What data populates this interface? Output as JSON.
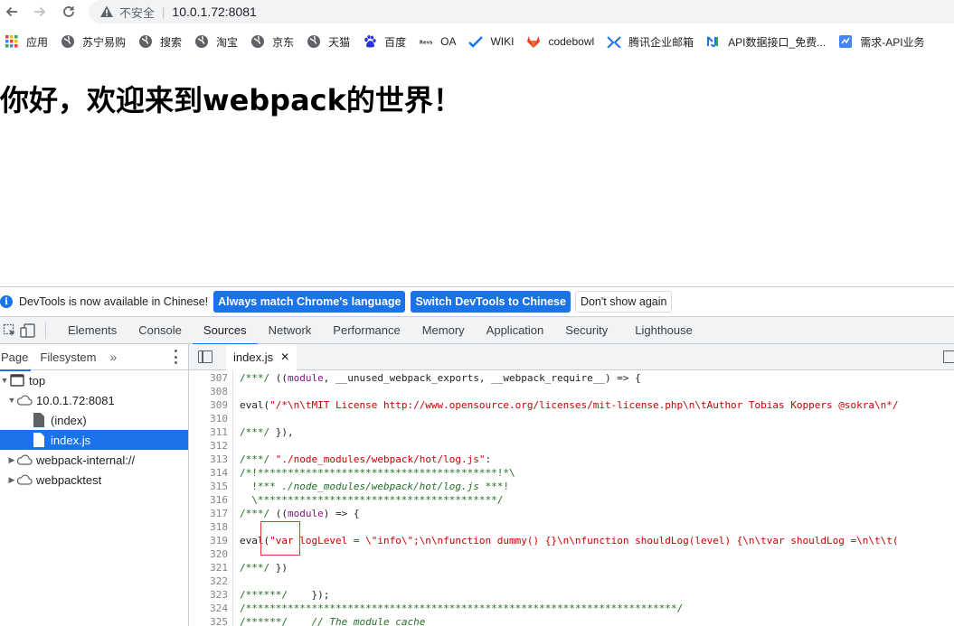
{
  "browser": {
    "insecure_label": "不安全",
    "separator": "|",
    "url": "10.0.1.72:8081"
  },
  "bookmarks": [
    {
      "label": "应用",
      "icon": "apps-grid-icon"
    },
    {
      "label": "苏宁易购",
      "icon": "globe-icon"
    },
    {
      "label": "搜索",
      "icon": "globe-icon"
    },
    {
      "label": "淘宝",
      "icon": "globe-icon"
    },
    {
      "label": "京东",
      "icon": "globe-icon"
    },
    {
      "label": "天猫",
      "icon": "globe-icon"
    },
    {
      "label": "百度",
      "icon": "baidu-paw-icon"
    },
    {
      "label": "OA",
      "icon": "oa-logo-icon"
    },
    {
      "label": "WIKI",
      "icon": "wiki-check-icon"
    },
    {
      "label": "codebowl",
      "icon": "gitlab-fox-icon"
    },
    {
      "label": "腾讯企业邮箱",
      "icon": "tencent-mail-icon"
    },
    {
      "label": "API数据接口_免费...",
      "icon": "api-logo-icon"
    },
    {
      "label": "需求-API业务",
      "icon": "document-icon"
    }
  ],
  "page": {
    "heading": "你好，欢迎来到webpack的世界！"
  },
  "infobar": {
    "message": "DevTools is now available in Chinese!",
    "btn_match": "Always match Chrome's language",
    "btn_switch": "Switch DevTools to Chinese",
    "btn_dismiss": "Don't show again"
  },
  "devtools": {
    "tabs": [
      "Elements",
      "Console",
      "Sources",
      "Network",
      "Performance",
      "Memory",
      "Application",
      "Security",
      "Lighthouse"
    ],
    "active_tab": "Sources"
  },
  "navigator": {
    "tab_page": "Page",
    "tab_filesystem": "Filesystem",
    "more": "»",
    "tree": [
      {
        "label": "top",
        "arrow": "▼",
        "indent": 0,
        "icon": "frame-icon"
      },
      {
        "label": "10.0.1.72:8081",
        "arrow": "▼",
        "indent": 1,
        "icon": "cloud-icon"
      },
      {
        "label": "(index)",
        "arrow": "",
        "indent": 2,
        "icon": "file-icon"
      },
      {
        "label": "index.js",
        "arrow": "",
        "indent": 2,
        "icon": "file-icon",
        "selected": true
      },
      {
        "label": "webpack-internal://",
        "arrow": "▶",
        "indent": 1,
        "icon": "cloud-icon"
      },
      {
        "label": "webpacktest",
        "arrow": "▶",
        "indent": 1,
        "icon": "cloud-icon"
      }
    ]
  },
  "editor": {
    "file_tab": "index.js",
    "close": "✕",
    "lines": [
      {
        "n": "307",
        "parts": [
          [
            "c-comment",
            "/***/ "
          ],
          [
            "c-plain",
            "(("
          ],
          [
            "c-kw",
            "module"
          ],
          [
            "c-plain",
            ", __unused_webpack_exports, __webpack_require__) => {"
          ]
        ]
      },
      {
        "n": "308",
        "parts": []
      },
      {
        "n": "309",
        "parts": [
          [
            "c-plain",
            "eval("
          ],
          [
            "c-str",
            "\"/*\\n\\tMIT License http://www.opensource.org/licenses/mit-license.php\\n\\tAuthor Tobias Koppers @sokra\\n*/"
          ]
        ]
      },
      {
        "n": "310",
        "parts": []
      },
      {
        "n": "311",
        "parts": [
          [
            "c-comment",
            "/***/ "
          ],
          [
            "c-plain",
            "}),"
          ]
        ]
      },
      {
        "n": "312",
        "parts": []
      },
      {
        "n": "313",
        "parts": [
          [
            "c-comment",
            "/***/ "
          ],
          [
            "c-str",
            "\"./node_modules/webpack/hot/log.js\""
          ],
          [
            "c-plain",
            ":"
          ]
        ]
      },
      {
        "n": "314",
        "parts": [
          [
            "c-comment",
            "/*!****************************************!*\\"
          ]
        ]
      },
      {
        "n": "315",
        "parts": [
          [
            "c-comment",
            "  !*** "
          ],
          [
            "c-ital",
            "./node_modules/webpack/hot/log.js"
          ],
          [
            "c-comment",
            " ***!"
          ]
        ]
      },
      {
        "n": "316",
        "parts": [
          [
            "c-comment",
            "  \\****************************************/"
          ]
        ]
      },
      {
        "n": "317",
        "parts": [
          [
            "c-comment",
            "/***/ "
          ],
          [
            "c-plain",
            "(("
          ],
          [
            "c-kw",
            "module"
          ],
          [
            "c-plain",
            ") => {"
          ]
        ]
      },
      {
        "n": "318",
        "parts": []
      },
      {
        "n": "319",
        "parts": [
          [
            "c-plain",
            "eval("
          ],
          [
            "c-str",
            "\"var logLevel = \\\"info\\\";\\n\\nfunction dummy() {}\\n\\nfunction shouldLog(level) {\\n\\tvar shouldLog =\\n\\t\\t("
          ]
        ]
      },
      {
        "n": "320",
        "parts": []
      },
      {
        "n": "321",
        "parts": [
          [
            "c-comment",
            "/***/ "
          ],
          [
            "c-plain",
            "})"
          ]
        ]
      },
      {
        "n": "322",
        "parts": []
      },
      {
        "n": "323",
        "parts": [
          [
            "c-comment",
            "/******/    "
          ],
          [
            "c-plain",
            "});"
          ]
        ]
      },
      {
        "n": "324",
        "parts": [
          [
            "c-comment",
            "/************************************************************************/"
          ]
        ]
      },
      {
        "n": "325",
        "parts": [
          [
            "c-comment",
            "/******/    "
          ],
          [
            "c-ital",
            "// The module cache"
          ]
        ]
      }
    ]
  }
}
